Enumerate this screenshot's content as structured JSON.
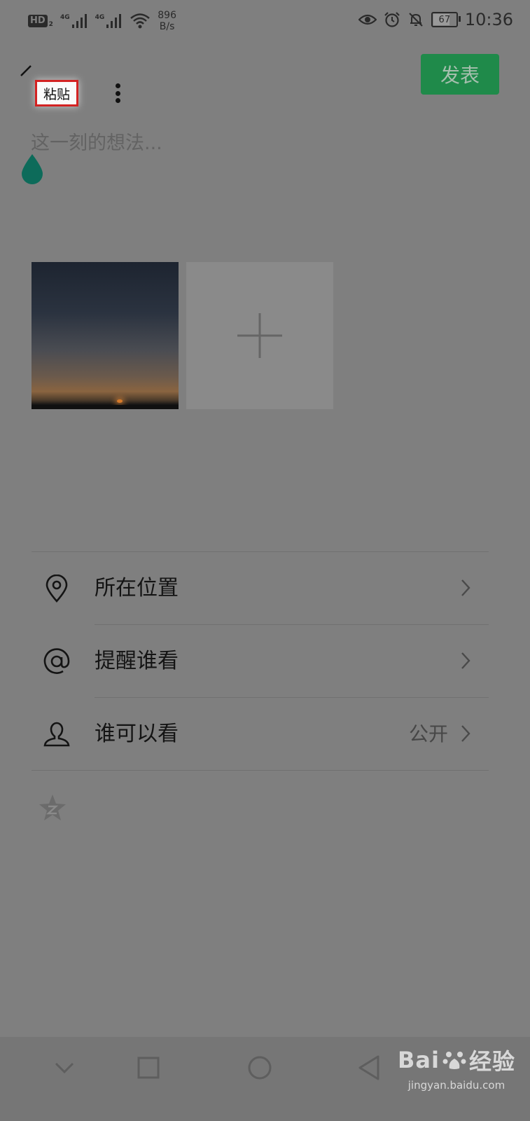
{
  "status_bar": {
    "hd_badge": "HD",
    "hd_sub": "2",
    "net_left": "4G",
    "net_right": "4G",
    "speed_value": "896",
    "speed_unit": "B/s",
    "battery": "67",
    "battery_level": 0.67,
    "time": "10:36",
    "icons": [
      "eye-icon",
      "alarm-icon",
      "mute-bell-icon",
      "battery-icon"
    ]
  },
  "toolbar": {
    "paste_label": "粘贴",
    "publish_label": "发表"
  },
  "post": {
    "placeholder": "这一刻的想法..."
  },
  "menu": [
    {
      "icon": "location-pin-icon",
      "label": "所在位置",
      "value": ""
    },
    {
      "icon": "at-icon",
      "label": "提醒谁看",
      "value": ""
    },
    {
      "icon": "person-icon",
      "label": "谁可以看",
      "value": "公开"
    }
  ],
  "watermark": {
    "brand": "Bai",
    "brand_cn": "经验",
    "url": "jingyan.baidu.com"
  },
  "colors": {
    "overlay": "#7f7f7f",
    "publish_button": "#1f8a4a",
    "highlight_border": "#d32222",
    "drop_handle": "#0d6b5a"
  }
}
